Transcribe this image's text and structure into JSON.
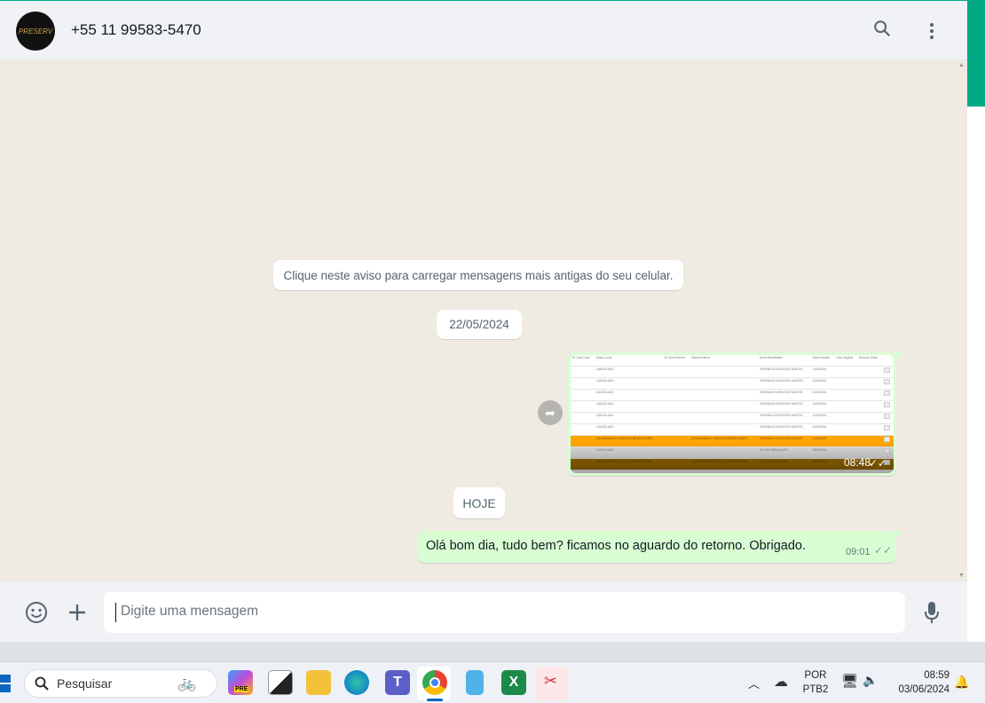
{
  "header": {
    "contact": "+55 11 99583-5470",
    "avatar_text": "PRESERV",
    "search_icon": "search-icon",
    "menu_icon": "kebab-menu-icon"
  },
  "chat": {
    "load_older_notice": "Clique neste aviso para carregar mensagens mais antigas do seu celular.",
    "date_1": "22/05/2024",
    "image_message": {
      "time": "08:48",
      "status": "read",
      "table_headers": [
        "Nº Guia Local",
        "Status Local",
        "Nº Guia Externa",
        "Status Externo",
        "Nome Beneficiário",
        "Data Inclusão",
        "Guia Original",
        "Recurso Glosa"
      ],
      "rows": [
        {
          "status": "CANCELADO",
          "name": "VERONICA SOFIA DOS SANTOS",
          "date": "11/03/2024",
          "style": "normal"
        },
        {
          "status": "CANCELADO",
          "name": "VERONICA SOFIA DOS SANTOS",
          "date": "11/03/2024",
          "style": "normal"
        },
        {
          "status": "CANCELADO",
          "name": "VERONICA SOFIA DOS SANTOS",
          "date": "11/03/2024",
          "style": "normal"
        },
        {
          "status": "CANCELADO",
          "name": "VERONICA SOFIA DOS SANTOS",
          "date": "11/03/2024",
          "style": "normal"
        },
        {
          "status": "CANCELADO",
          "name": "VERONICA SOFIA DOS SANTOS",
          "date": "11/03/2024",
          "style": "normal"
        },
        {
          "status": "CANCELADO",
          "name": "VERONICA SOFIA DOS SANTOS",
          "date": "11/03/2024",
          "style": "normal"
        },
        {
          "status": "AGUARDANDO TOKEN DO BENEFICIÁRIO",
          "ext_status": "AGUARDANDO TOKEN DO BENEFICIÁRIO",
          "name": "VERONICA SOFIA DOS SANTOS",
          "date": "11/03/2024",
          "style": "orange"
        },
        {
          "status": "CANCELADO",
          "name": "ELLOAH MAIA ALVES",
          "date": "09/03/2024",
          "style": "grey"
        },
        {
          "status": "AGUARDANDO TOKEN DO BENEFICIÁRIO",
          "ext_status": "AGUARDANDO TOKEN DO BENEFICIÁRIO",
          "name": "ELLOAH MAIA ALVES",
          "date": "09/03/2024",
          "style": "dark"
        }
      ]
    },
    "date_2": "HOJE",
    "text_message": {
      "text": "Olá bom dia, tudo bem? ficamos no aguardo do retorno. Obrigado.",
      "time": "09:01",
      "status": "read"
    }
  },
  "composer": {
    "placeholder": "Digite uma mensagem",
    "emoji_icon": "emoji-icon",
    "attach_icon": "plus-icon",
    "mic_icon": "microphone-icon"
  },
  "taskbar": {
    "search_placeholder": "Pesquisar",
    "copilot_badge": "PRE",
    "language_line1": "POR",
    "language_line2": "PTB2",
    "time": "08:59",
    "date": "03/06/2024",
    "apps": [
      "copilot",
      "task-view",
      "file-explorer",
      "edge",
      "teams",
      "chrome",
      "notepad",
      "excel",
      "snipping-tool"
    ]
  }
}
